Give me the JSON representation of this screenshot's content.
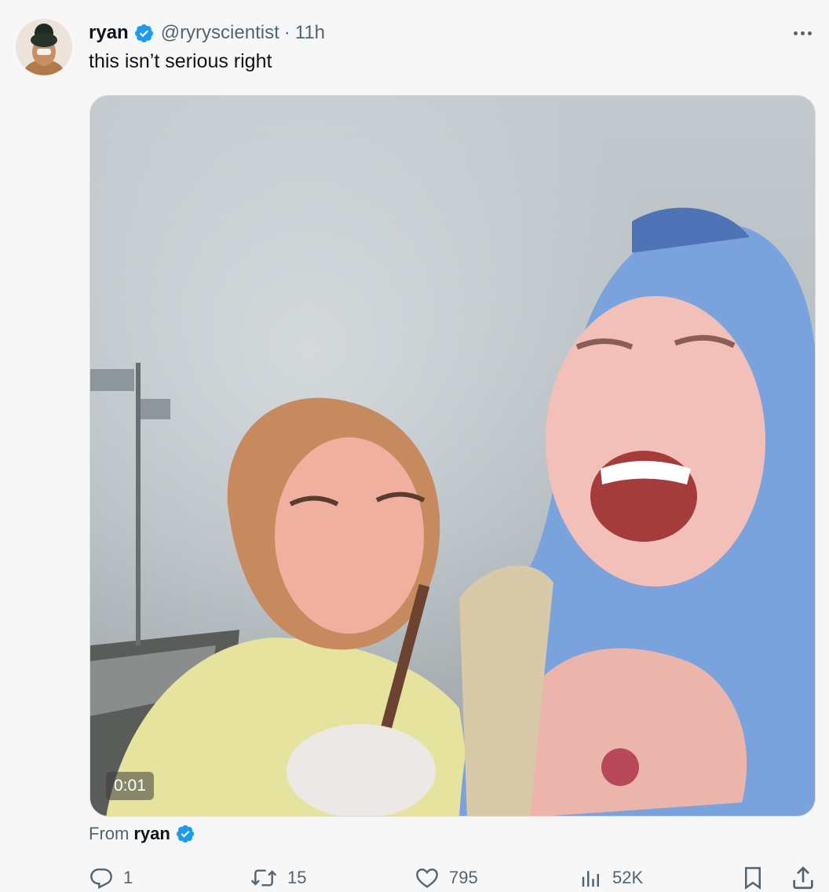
{
  "tweet": {
    "author_name": "ryan",
    "handle": "@ryryscientist",
    "separator": "·",
    "time": "11h",
    "text": "this isn’t serious right",
    "media": {
      "duration": "0:01"
    },
    "from_label": "From",
    "from_name": "ryan"
  },
  "actions": {
    "replies": "1",
    "reposts": "15",
    "likes": "795",
    "views": "52K"
  },
  "icons": {
    "verified": "verified-badge-icon",
    "more": "more-icon",
    "reply": "reply-icon",
    "repost": "repost-icon",
    "like": "heart-icon",
    "views": "views-chart-icon",
    "bookmark": "bookmark-icon",
    "share": "share-icon"
  },
  "colors": {
    "verified_blue": "#1d9bf0",
    "secondary_text": "#536471",
    "primary_text": "#0f1419"
  }
}
